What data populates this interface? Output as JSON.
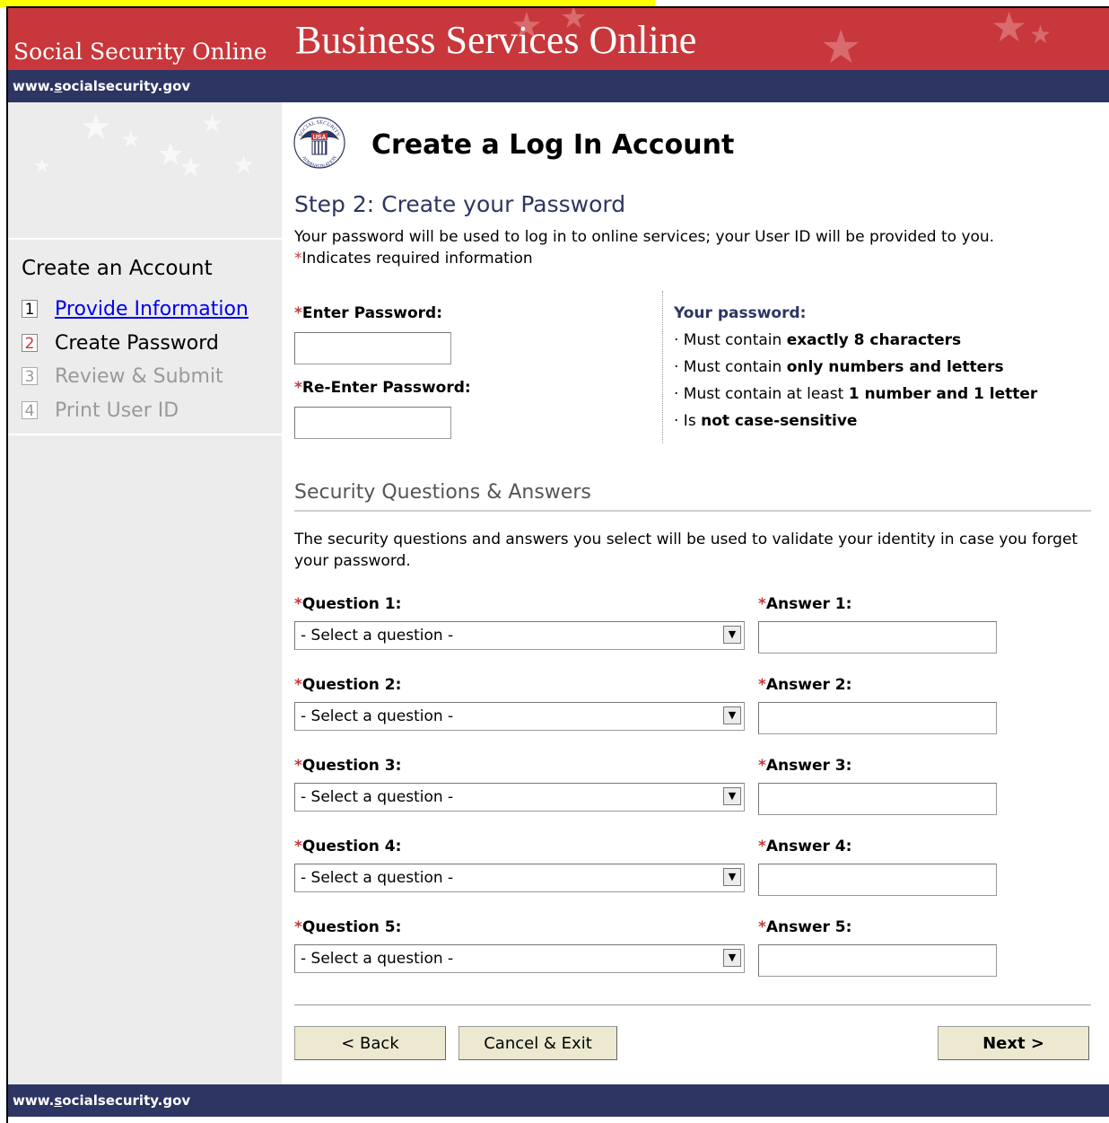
{
  "header": {
    "org_name": "Social Security Online",
    "site_title": "Business Services Online",
    "url_prefix": "www.",
    "url_underlined": "s",
    "url_rest": "ocialsecurity.gov"
  },
  "sidebar": {
    "title": "Create an Account",
    "steps": [
      {
        "num": "1",
        "label": "Provide Information",
        "state": "link"
      },
      {
        "num": "2",
        "label": "Create Password",
        "state": "current"
      },
      {
        "num": "3",
        "label": "Review & Submit",
        "state": "disabled"
      },
      {
        "num": "4",
        "label": "Print User ID",
        "state": "disabled"
      }
    ]
  },
  "page": {
    "title": "Create a Log In Account",
    "step_heading": "Step 2:  Create your Password",
    "intro": "Your password will be used to log in to online services; your User ID will be provided to you.",
    "required_star": "*",
    "required_note": "Indicates required information"
  },
  "password": {
    "enter_label": "Enter Password:",
    "reenter_label": "Re-Enter Password:",
    "enter_value": "",
    "reenter_value": ""
  },
  "rules": {
    "title": "Your password:",
    "items": [
      {
        "prefix": "· Must contain ",
        "bold": "exactly 8 characters"
      },
      {
        "prefix": "· Must contain ",
        "bold": "only numbers and letters"
      },
      {
        "prefix": "· Must contain at least ",
        "bold": "1 number and 1 letter"
      },
      {
        "prefix": "· Is ",
        "bold": "not case-sensitive"
      }
    ]
  },
  "security": {
    "heading": "Security Questions & Answers",
    "description": "The security questions and answers you select will be used to validate your identity in case you forget your password.",
    "questions": [
      {
        "q_label": "Question 1:",
        "a_label": "Answer 1:",
        "selected": "- Select a question -",
        "answer": ""
      },
      {
        "q_label": "Question 2:",
        "a_label": "Answer 2:",
        "selected": "- Select a question -",
        "answer": ""
      },
      {
        "q_label": "Question 3:",
        "a_label": "Answer 3:",
        "selected": "- Select a question -",
        "answer": ""
      },
      {
        "q_label": "Question 4:",
        "a_label": "Answer 4:",
        "selected": "- Select a question -",
        "answer": ""
      },
      {
        "q_label": "Question 5:",
        "a_label": "Answer 5:",
        "selected": "- Select a question -",
        "answer": ""
      }
    ]
  },
  "buttons": {
    "back": "< Back",
    "cancel": "Cancel & Exit",
    "next": "Next >"
  },
  "logo": {
    "top_text": "SOCIAL SECURITY",
    "bottom_text": "ADMINISTRATION",
    "badge_text": "USA"
  },
  "colors": {
    "banner_red": "#c8373b",
    "navy": "#2d3563",
    "sidebar_gray": "#ececec",
    "button_beige": "#ece9d0",
    "highlight_yellow": "#ffff00"
  }
}
